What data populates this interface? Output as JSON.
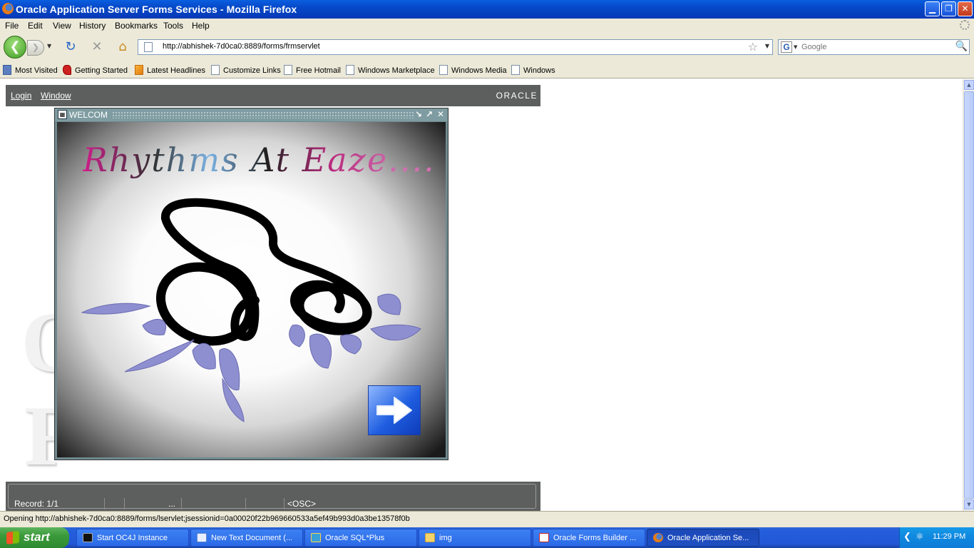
{
  "window": {
    "title": "Oracle Application Server Forms Services - Mozilla Firefox",
    "minimize": "▁",
    "restore": "❐",
    "close": "✕"
  },
  "menu": [
    "File",
    "Edit",
    "View",
    "History",
    "Bookmarks",
    "Tools",
    "Help"
  ],
  "nav": {
    "back_icon": "back-arrow",
    "reload_glyph": "↻",
    "stop_glyph": "✕",
    "home_glyph": "⌂",
    "url": "http://abhishek-7d0ca0:8889/forms/frmservlet",
    "search_placeholder": "Google",
    "search_engine": "G"
  },
  "bookmarks": [
    "Most Visited",
    "Getting Started",
    "Latest Headlines",
    "Customize Links",
    "Free Hotmail",
    "Windows Marketplace",
    "Windows Media",
    "Windows"
  ],
  "forms": {
    "menu_login": "Login",
    "menu_window": "Window",
    "brand": "ORACLE",
    "background_text_1": "O",
    "background_text_2": "F",
    "status_record": "Record: 1/1",
    "status_dots": "...",
    "status_osc": "<OSC>"
  },
  "welcome_window": {
    "title": "WELCOM",
    "banner_text": "Rhythms At Eaze....",
    "next_button_icon": "right-arrow-icon"
  },
  "status_bar": {
    "text": "Opening http://abhishek-7d0ca0:8889/forms/lservlet;jsessionid=0a00020f22b969660533a5ef49b993d0a3be13578f0b"
  },
  "taskbar": {
    "start_label": "start",
    "tasks": [
      "Start OC4J Instance",
      "New Text Document (...",
      "Oracle SQL*Plus",
      "img",
      "Oracle Forms Builder ...",
      "Oracle Application Se..."
    ],
    "clock": "11:29 PM"
  },
  "colors": {
    "titlebar": "#0a5fe0",
    "chrome": "#ece9d8",
    "forms_bar": "#5d5e5e",
    "welcome_title": "#7e9ca1",
    "taskbar": "#245edc",
    "start_button": "#3a9a3a"
  }
}
